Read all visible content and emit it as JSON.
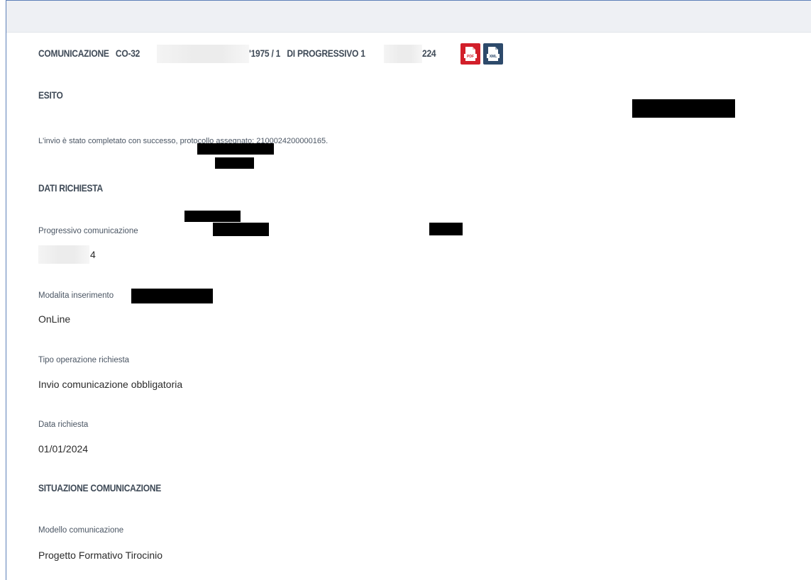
{
  "header": {
    "prefix": "COMUNICAZIONE",
    "code_start": "CO-32",
    "code_end": "'1975 / 1",
    "progressivo_label": "DI PROGRESSIVO",
    "progressivo_start": "1",
    "progressivo_end": "224",
    "pdf_button": "PDF",
    "xml_button": "XML"
  },
  "esito": {
    "title": "ESITO",
    "message": "L'invio è stato completato con successo, protocollo assegnato: 2100024200000165."
  },
  "dati_richiesta": {
    "title": "DATI RICHIESTA",
    "fields": [
      {
        "label": "Progressivo comunicazione",
        "value": "4"
      },
      {
        "label": "Modalita inserimento",
        "value": "OnLine"
      },
      {
        "label": "Tipo operazione richiesta",
        "value": "Invio comunicazione obbligatoria"
      },
      {
        "label": "Data richiesta",
        "value": "01/01/2024"
      }
    ]
  },
  "situazione": {
    "title": "SITUAZIONE COMUNICAZIONE",
    "fields": [
      {
        "label": "Modello comunicazione",
        "value": "Progetto Formativo Tirocinio"
      }
    ]
  },
  "colors": {
    "pdf": "#d21f2a",
    "xml": "#2d4a6b",
    "frame_border": "#5d7fb8"
  }
}
